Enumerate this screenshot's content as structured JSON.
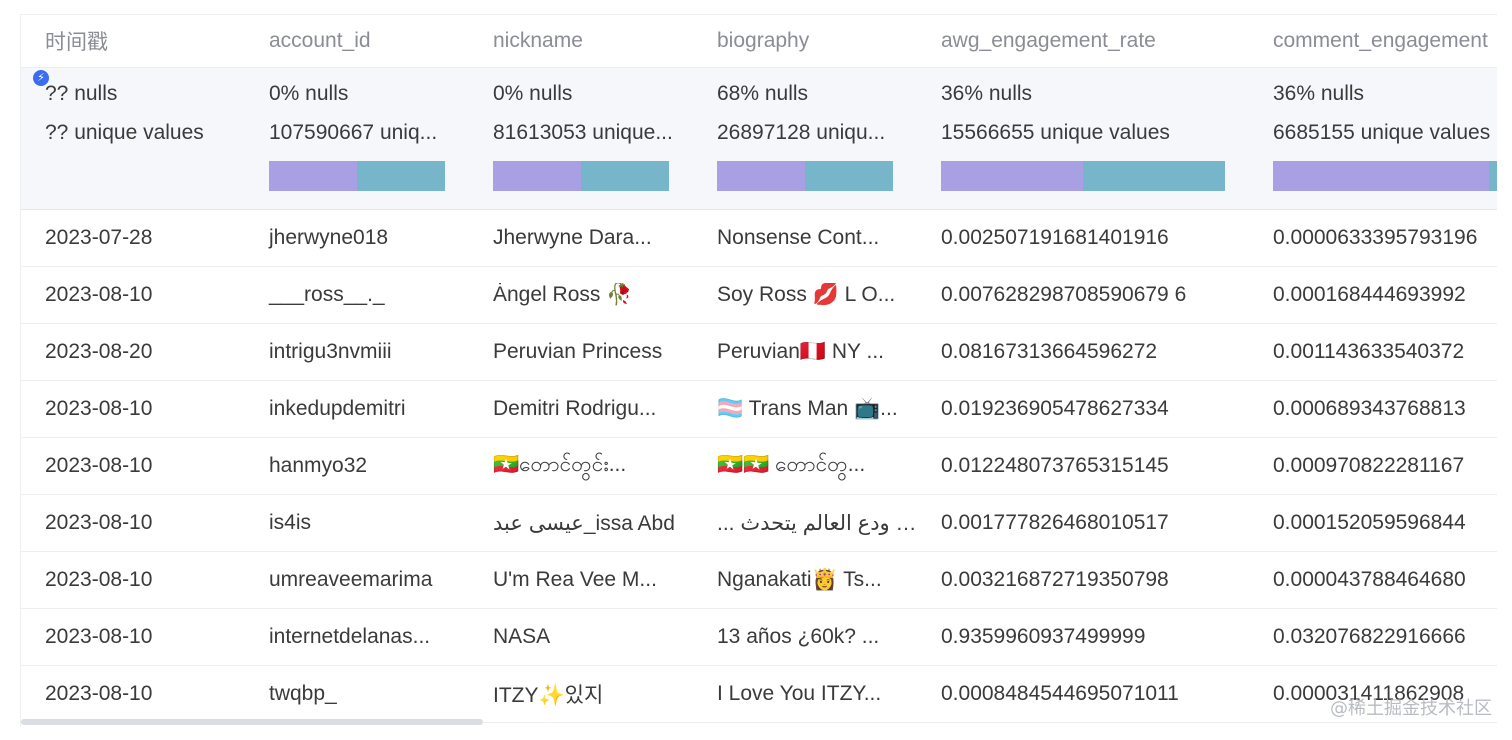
{
  "columns": [
    "时间戳",
    "account_id",
    "nickname",
    "biography",
    "awg_engagement_rate",
    "comment_engagement"
  ],
  "stats": [
    {
      "nulls": "?? nulls",
      "unique": "?? unique values",
      "bar": null
    },
    {
      "nulls": "0% nulls",
      "unique": "107590667 uniq...",
      "bar": [
        0.5,
        0.5
      ]
    },
    {
      "nulls": "0% nulls",
      "unique": "81613053 unique...",
      "bar": [
        0.5,
        0.5
      ]
    },
    {
      "nulls": "68% nulls",
      "unique": "26897128 uniqu...",
      "bar": [
        0.5,
        0.5
      ]
    },
    {
      "nulls": "36% nulls",
      "unique": "15566655 unique values",
      "bar": [
        0.5,
        0.5
      ]
    },
    {
      "nulls": "36% nulls",
      "unique": "6685155 unique values",
      "bar": [
        0.77,
        0.23
      ]
    }
  ],
  "rows": [
    [
      "2023-07-28",
      "jherwyne018",
      "Jherwyne Dara...",
      "Nonsense Cont...",
      "0.002507191681401916",
      "0.0000633395793196"
    ],
    [
      "2023-08-10",
      "___ross__._",
      "Ȧngel Ross 🥀",
      "Soy Ross 💋 L O...",
      "0.007628298708590679 6",
      "0.000168444693992"
    ],
    [
      "2023-08-20",
      "intrigu3nvmiii",
      "Peruvian Princess",
      "Peruvian🇵🇪 NY ...",
      "0.08167313664596272",
      "0.001143633540372"
    ],
    [
      "2023-08-10",
      "inkedupdemitri",
      "Demitri Rodrigu...",
      "🏳️‍⚧️ Trans Man 📺...",
      "0.019236905478627334",
      "0.000689343768813"
    ],
    [
      "2023-08-10",
      "hanmyo32",
      "🇲🇲တောင်တွင်း...",
      "🇲🇲🇲🇲 တောင်တွ...",
      "0.012248073765315145",
      "0.000970822281167"
    ],
    [
      "2023-08-10",
      "is4is",
      "عيسى عبد_issa Abd",
      "... لك ودع العالم يتحدث",
      "0.001777826468010517",
      "0.000152059596844"
    ],
    [
      "2023-08-10",
      "umreaveemarima",
      "U'm Rea Vee M...",
      "Nganakati👸 Ts...",
      "0.003216872719350798",
      "0.000043788464680"
    ],
    [
      "2023-08-10",
      "internetdelanas...",
      "NASA",
      "13 años ¿60k? ...",
      "0.9359960937499999",
      "0.032076822916666"
    ],
    [
      "2023-08-10",
      "twqbp_",
      "ITZY✨있지",
      "I Love You ITZY...",
      "0.0008484544695071011",
      "0.000031411862908"
    ]
  ],
  "colors": {
    "bar_a": "#a99fe3",
    "bar_b": "#77b5cb",
    "stats_bg": "#f5f7fa",
    "badge": "#3a6df0"
  },
  "watermark": "@稀土掘金技术社区",
  "badge_icon": "lightning-icon"
}
